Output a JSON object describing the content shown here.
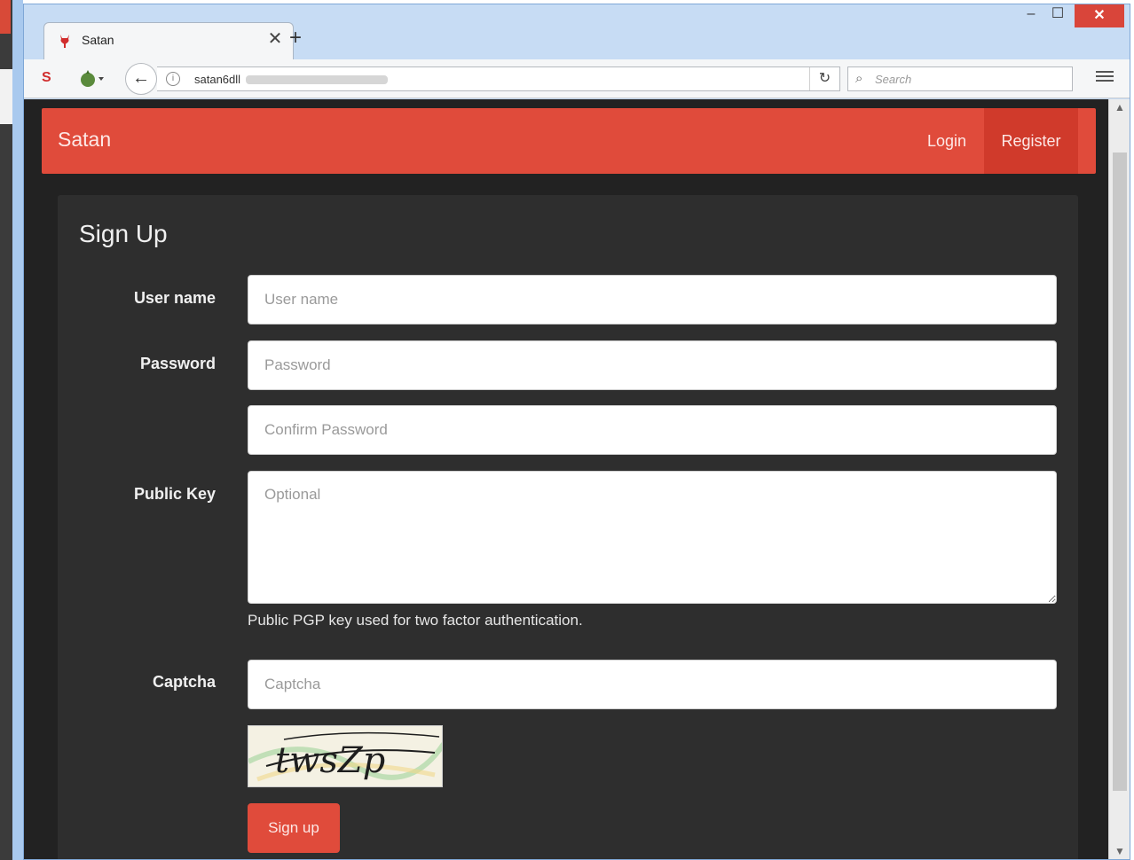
{
  "browser": {
    "tab_title": "Satan",
    "url_text": "satan6dll",
    "search_placeholder": "Search",
    "minimize_glyph": "–",
    "maximize_glyph": "☐",
    "close_glyph": "✕",
    "new_tab_glyph": "+",
    "tab_close_glyph": "✕"
  },
  "site": {
    "brand": "Satan",
    "nav": {
      "login": "Login",
      "register": "Register"
    }
  },
  "form": {
    "title": "Sign Up",
    "username": {
      "label": "User name",
      "placeholder": "User name"
    },
    "password": {
      "label": "Password",
      "placeholder": "Password"
    },
    "confirm_password": {
      "placeholder": "Confirm Password"
    },
    "public_key": {
      "label": "Public Key",
      "placeholder": "Optional",
      "help": "Public PGP key used for two factor authentication."
    },
    "captcha": {
      "label": "Captcha",
      "placeholder": "Captcha",
      "image_text": "twsZp"
    },
    "submit": "Sign up"
  },
  "colors": {
    "accent": "#e04b3b",
    "accent_dark": "#d03a2b",
    "page_bg": "#222222",
    "panel_bg": "#2e2e2e"
  }
}
